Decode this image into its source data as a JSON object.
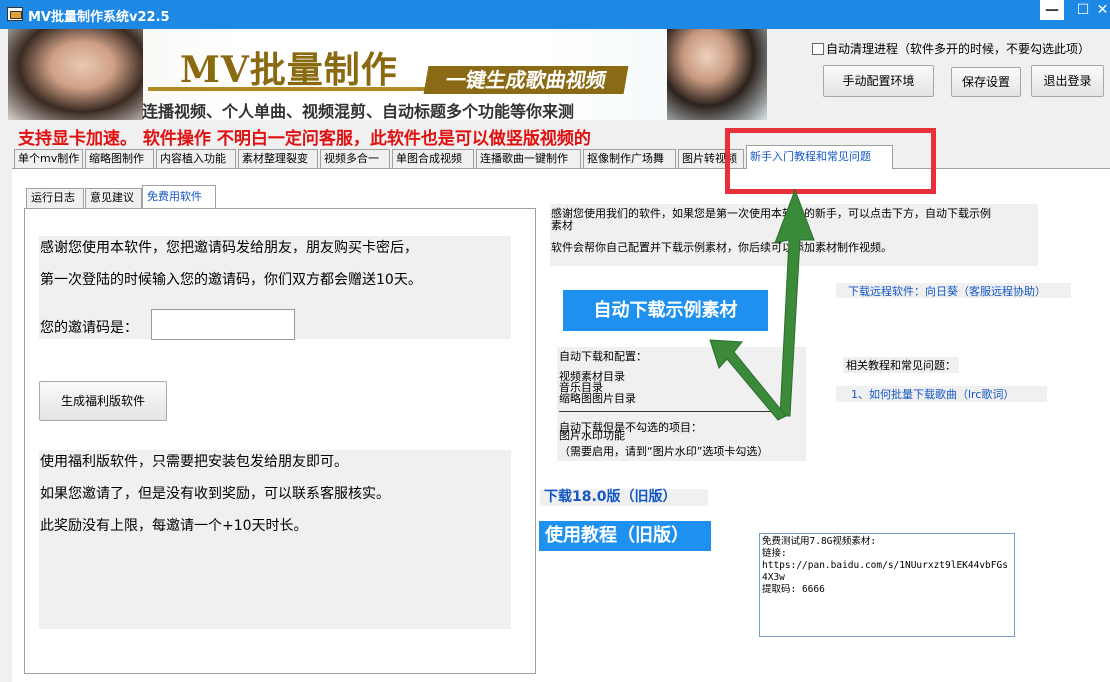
{
  "window": {
    "title": "MV批量制作系统v22.5",
    "minimize": "—",
    "maximize": "☐",
    "close": "✕"
  },
  "banner": {
    "title": "MV批量制作",
    "badge": "一键生成歌曲视频",
    "subtitle": "连播视频、个人单曲、视频混剪、自动标题多个功能等你来测"
  },
  "top_right": {
    "auto_clean_label": "自动清理进程（软件多开的时候，不要勾选此项）",
    "manual_config_button": "手动配置环境",
    "save_settings_button": "保存设置",
    "logout_button": "退出登录"
  },
  "notice": "支持显卡加速。 软件操作 不明白一定问客服，此软件也是可以做竖版视频的",
  "tabs": [
    {
      "label": "单个mv制作"
    },
    {
      "label": "缩略图制作"
    },
    {
      "label": "内容植入功能"
    },
    {
      "label": "素材整理裂变"
    },
    {
      "label": "视频多合一"
    },
    {
      "label": "单图合成视频"
    },
    {
      "label": "连播歌曲一键制作"
    },
    {
      "label": "抠像制作广场舞"
    },
    {
      "label": "图片转视频"
    },
    {
      "label": "新手入门教程和常见问题"
    }
  ],
  "inner_tabs": [
    {
      "label": "运行日志"
    },
    {
      "label": "意见建议"
    },
    {
      "label": "免费用软件"
    }
  ],
  "free_software": {
    "line1": "感谢您使用本软件，您把邀请码发给朋友，朋友购买卡密后，",
    "line2": "第一次登陆的时候输入您的邀请码，你们双方都会赠送10天。",
    "invite_label": "您的邀请码是：",
    "invite_value": "",
    "generate_button": "生成福利版软件",
    "info1": "使用福利版软件，只需要把安装包发给朋友即可。",
    "info2": "如果您邀请了，但是没有收到奖励，可以联系客服核实。",
    "info3": "此奖励没有上限，每邀请一个+10天时长。"
  },
  "tutorial": {
    "intro1": "感谢您使用我们的软件，如果您是第一次使用本软件的新手，可以点击下方，自动下载示例",
    "intro1b": "素材",
    "intro2": "软件会帮你自己配置并下载示例素材，你后续可以添加素材制作视频。",
    "download_button": "自动下载示例素材",
    "remote_link": "下载远程软件：向日葵（客服远程协助）",
    "auto_header": "自动下载和配置：",
    "auto_items": [
      "视频素材目录",
      "音乐目录",
      "缩略图图片目录"
    ],
    "unchecked_header": "自动下载但是不勾选的项目：",
    "unchecked_item": "图片水印功能",
    "unchecked_note": "（需要启用，请到“图片水印”选项卡勾选）",
    "faq_header": "相关教程和常见问题：",
    "faq_link": "1、如何批量下载歌曲（lrc歌词）",
    "old_download": "下载18.0版（旧版）",
    "old_tutorial": "使用教程（旧版）",
    "note": "免费测试用7.8G视频素材:\n链接:\nhttps://pan.baidu.com/s/1NUurxzt9lEK44vbFGs4X3w\n提取码: 6666"
  },
  "colors": {
    "title_bar": "#1e88e5",
    "accent_blue": "#1e90f0",
    "notice_red": "#e01010",
    "highlight_red": "#e8303a",
    "arrow_green": "#3a8a3a"
  }
}
